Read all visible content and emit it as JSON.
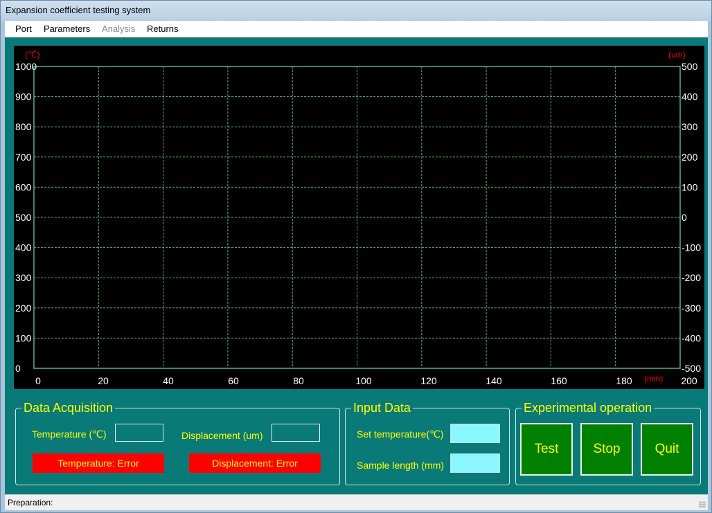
{
  "window": {
    "title": "Expansion coefficient testing system"
  },
  "menu": {
    "items": [
      {
        "label": "Port",
        "enabled": true
      },
      {
        "label": "Parameters",
        "enabled": true
      },
      {
        "label": "Analysis",
        "enabled": false
      },
      {
        "label": "Returns",
        "enabled": true
      }
    ]
  },
  "chart_data": {
    "type": "line",
    "series": [],
    "x": {
      "label": "(min)",
      "range": [
        0,
        200
      ],
      "ticks": [
        "0",
        "20",
        "40",
        "60",
        "80",
        "100",
        "120",
        "140",
        "160",
        "180",
        "200"
      ]
    },
    "y_left": {
      "label": "(℃)",
      "range": [
        0,
        1000
      ],
      "ticks": [
        "0",
        "100",
        "200",
        "300",
        "400",
        "500",
        "600",
        "700",
        "800",
        "900",
        "1000"
      ]
    },
    "y_right": {
      "label": "(um)",
      "range": [
        -500,
        500
      ],
      "ticks": [
        "-500",
        "-400",
        "-300",
        "-200",
        "-100",
        "0",
        "100",
        "200",
        "300",
        "400",
        "500"
      ]
    },
    "grid": true,
    "colors": {
      "background": "#000000",
      "grid": "#4fb38d",
      "tick_label": "#ffffff",
      "unit_label": "#ff0000"
    }
  },
  "acquisition": {
    "title": "Data Acquisition",
    "temperature_label": "Temperature (℃)",
    "temperature_value": "",
    "displacement_label": "Displacement (um)",
    "displacement_value": "",
    "temperature_status": "Temperature: Error",
    "displacement_status": "Displacement: Error"
  },
  "input": {
    "title": "Input Data",
    "set_temperature_label": "Set temperature(℃)",
    "set_temperature_value": "",
    "sample_length_label": "Sample length (mm)",
    "sample_length_value": ""
  },
  "operation": {
    "title": "Experimental operation",
    "test_label": "Test",
    "stop_label": "Stop",
    "quit_label": "Quit"
  },
  "status": {
    "text": "Preparation:"
  },
  "colors": {
    "panel": "#0a7a78",
    "accent_text": "#ffff00",
    "button": "#008000",
    "error": "#ff0000",
    "input_fill": "#8af7ff"
  }
}
